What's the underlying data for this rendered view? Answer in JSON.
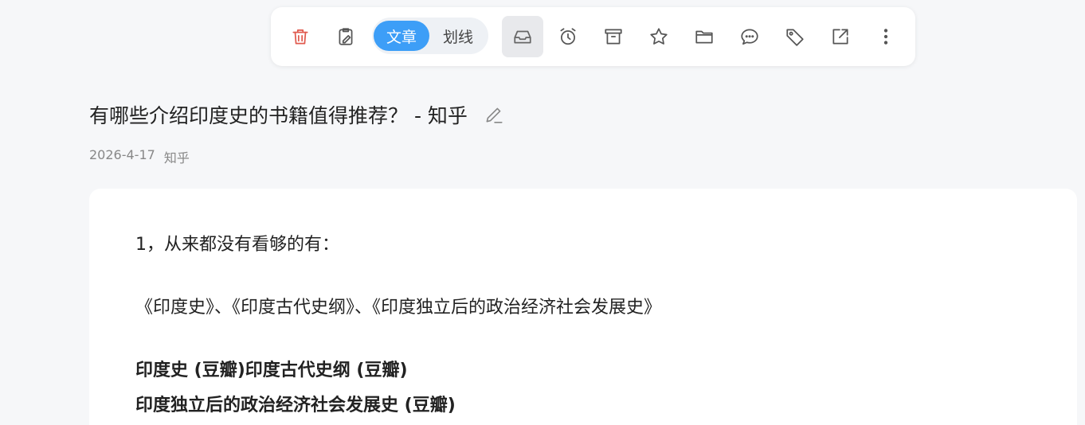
{
  "toolbar": {
    "segment": {
      "active": "文章",
      "inactive": "划线"
    },
    "icons": [
      "trash-icon",
      "clipboard-edit-icon",
      "inbox-icon",
      "alarm-clock-icon",
      "archive-icon",
      "star-icon",
      "folder-icon",
      "comment-icon",
      "tag-icon",
      "external-link-icon",
      "more-vertical-icon"
    ],
    "colors": {
      "accent": "#3d9ef7",
      "danger": "#e05a4e"
    }
  },
  "article": {
    "title": "有哪些介绍印度史的书籍值得推荐？ - 知乎",
    "date": "2026-4-17",
    "source": "知乎",
    "paragraphs": [
      {
        "text": "1，从来都没有看够的有：",
        "bold": false
      },
      {
        "text": "《印度史》、《印度古代史纲》、《印度独立后的政治经济社会发展史》",
        "bold": false
      },
      {
        "text": "印度史 (豆瓣)印度古代史纲 (豆瓣)",
        "bold": true
      },
      {
        "text": "印度独立后的政治经济社会发展史 (豆瓣)",
        "bold": true
      }
    ]
  }
}
